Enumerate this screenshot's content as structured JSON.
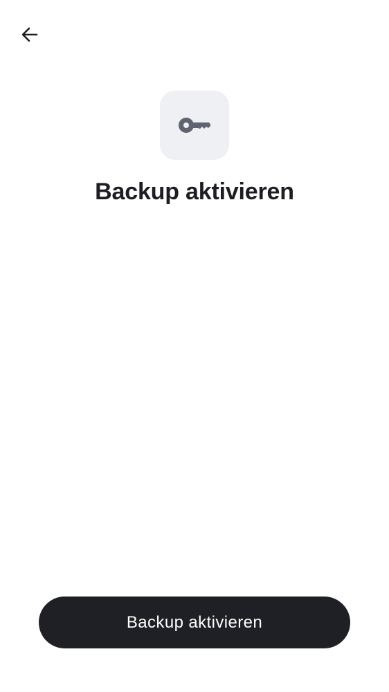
{
  "header": {
    "back_icon": "arrow-left-icon"
  },
  "hero": {
    "icon": "key-icon",
    "title": "Backup aktivieren"
  },
  "footer": {
    "primary_button_label": "Backup aktivieren"
  },
  "colors": {
    "background": "#ffffff",
    "text": "#1d1e23",
    "icon_tile": "#eff0f4",
    "icon": "#5f6470",
    "button_background": "#1f2025",
    "button_text": "#ffffff"
  }
}
